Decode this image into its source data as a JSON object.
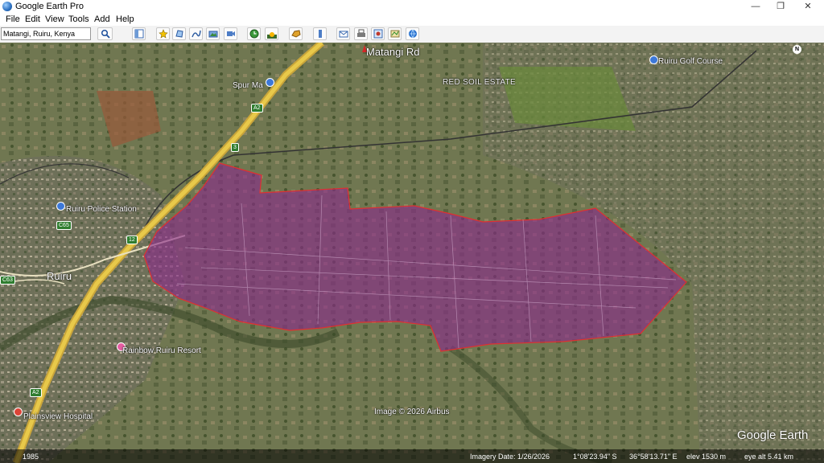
{
  "window": {
    "title": "Google Earth Pro",
    "min_label": "—",
    "max_label": "❐",
    "close_label": "✕"
  },
  "menu": {
    "file": "File",
    "edit": "Edit",
    "view": "View",
    "tools": "Tools",
    "add": "Add",
    "help": "Help"
  },
  "search": {
    "value": "Matangi, Ruiru, Kenya"
  },
  "map": {
    "places": {
      "matangi_rd": "Matangi Rd",
      "red_soil": "RED SOIL ESTATE",
      "ruiru_golf": "Ruiru Golf Course",
      "spur_mall": "Spur Ma",
      "police": "Ruiru Police Station",
      "ruiru": "Ruiru",
      "rainbow": "Rainbow Ruiru Resort",
      "plainsview": "Plainsview Hospital"
    },
    "roads": {
      "a2_upper": "A2",
      "a2_lower": "A2",
      "c65": "C65",
      "c63": "C63",
      "n12": "12",
      "n3": "3"
    },
    "image_credit": "Image © 2026 Airbus",
    "compass": "N",
    "polygon_fill": "#8a2a8a",
    "polygon_stroke": "#e03030"
  },
  "status": {
    "year": "1985",
    "imagery_date": "Imagery Date: 1/26/2026",
    "lat": "1°08'23.94\" S",
    "lon": "36°58'13.71\" E",
    "elev": "elev  1530 m",
    "eye_alt": "eye alt   5.41 km"
  },
  "watermark": "Google Earth"
}
